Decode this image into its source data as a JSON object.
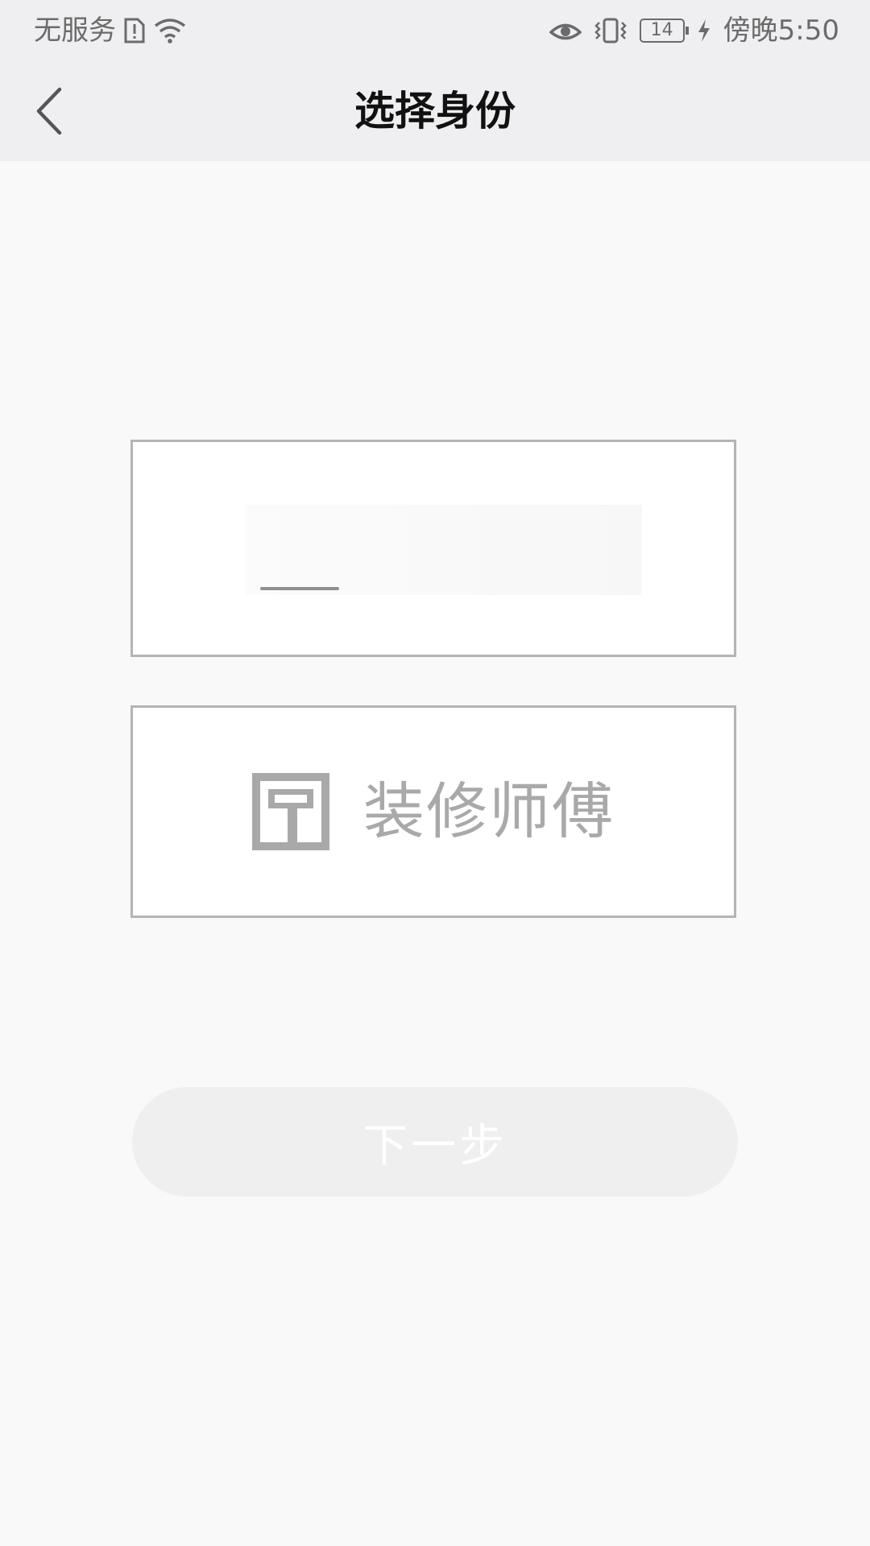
{
  "status_bar": {
    "carrier": "无服务",
    "battery_level": "14",
    "time": "傍晚5:50",
    "icons": [
      "sim-alert-icon",
      "wifi-icon",
      "eye-icon",
      "vibrate-icon",
      "battery-icon",
      "charging-icon"
    ]
  },
  "header": {
    "title": "选择身份",
    "back_icon": "chevron-left-icon"
  },
  "roles": {
    "worker": {
      "label": "装修师傅",
      "icon": "paint-roller-icon"
    }
  },
  "actions": {
    "next_label": "下一步"
  },
  "colors": {
    "background": "#f9f9f9",
    "header_bg": "#efeff1",
    "card_border": "#b4b4b4",
    "muted_text": "#a9a9a9",
    "button_bg": "#efefef"
  }
}
